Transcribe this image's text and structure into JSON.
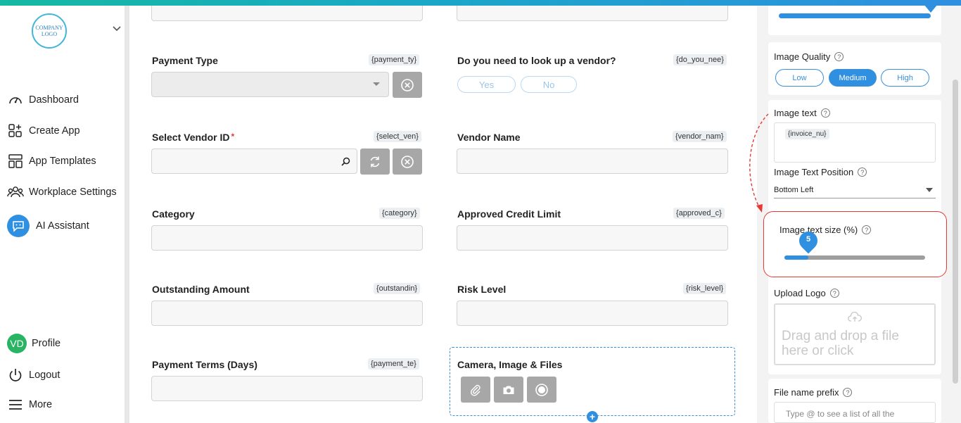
{
  "sidebar": {
    "logo_text": "COMPANY LOGO",
    "items": [
      {
        "label": "Dashboard",
        "icon": "speedometer-icon"
      },
      {
        "label": "Create App",
        "icon": "create-app-icon"
      },
      {
        "label": "App Templates",
        "icon": "templates-icon"
      },
      {
        "label": "Workplace Settings",
        "icon": "users-icon"
      },
      {
        "label": "AI Assistant",
        "icon": "ai-assistant-icon"
      }
    ],
    "bottom": [
      {
        "label": "Profile",
        "avatar": "VD"
      },
      {
        "label": "Logout",
        "icon": "power-icon"
      },
      {
        "label": "More",
        "icon": "menu-icon"
      }
    ]
  },
  "form": {
    "payment_type": {
      "label": "Payment Type",
      "tag": "{payment_ty}"
    },
    "lookup_vendor": {
      "label": "Do you need to look up a vendor?",
      "tag": "{do_you_nee}",
      "yes": "Yes",
      "no": "No"
    },
    "select_vendor": {
      "label": "Select Vendor ID",
      "required": "*",
      "tag": "{select_ven}"
    },
    "vendor_name": {
      "label": "Vendor Name",
      "tag": "{vendor_nam}"
    },
    "category": {
      "label": "Category",
      "tag": "{category}"
    },
    "approved_credit": {
      "label": "Approved Credit Limit",
      "tag": "{approved_c}"
    },
    "outstanding": {
      "label": "Outstanding Amount",
      "tag": "{outstandin}"
    },
    "risk_level": {
      "label": "Risk Level",
      "tag": "{risk_level}"
    },
    "payment_terms": {
      "label": "Payment Terms (Days)",
      "tag": "{payment_te}"
    },
    "camera": {
      "label": "Camera, Image & Files"
    }
  },
  "panel": {
    "image_quality": {
      "label": "Image Quality",
      "help": "?",
      "options": [
        "Low",
        "Medium",
        "High"
      ],
      "selected": "Medium"
    },
    "image_text": {
      "label": "Image text",
      "help": "?",
      "chip": "{invoice_nu}"
    },
    "image_text_position": {
      "label": "Image Text Position",
      "help": "?",
      "value": "Bottom Left"
    },
    "image_text_size": {
      "label": "Image text size (%)",
      "help": "?",
      "value": "5",
      "fill_fraction": 0.17
    },
    "upload_logo": {
      "label": "Upload Logo",
      "help": "?",
      "dropzone": "Drag and drop a file here or click"
    },
    "file_name_prefix": {
      "label": "File name prefix",
      "help": "?",
      "placeholder": "Type @ to see a list of all the"
    }
  },
  "colors": {
    "accent": "#2f8fe0",
    "highlight": "#e53935",
    "gray_button": "#a7a7a7"
  }
}
